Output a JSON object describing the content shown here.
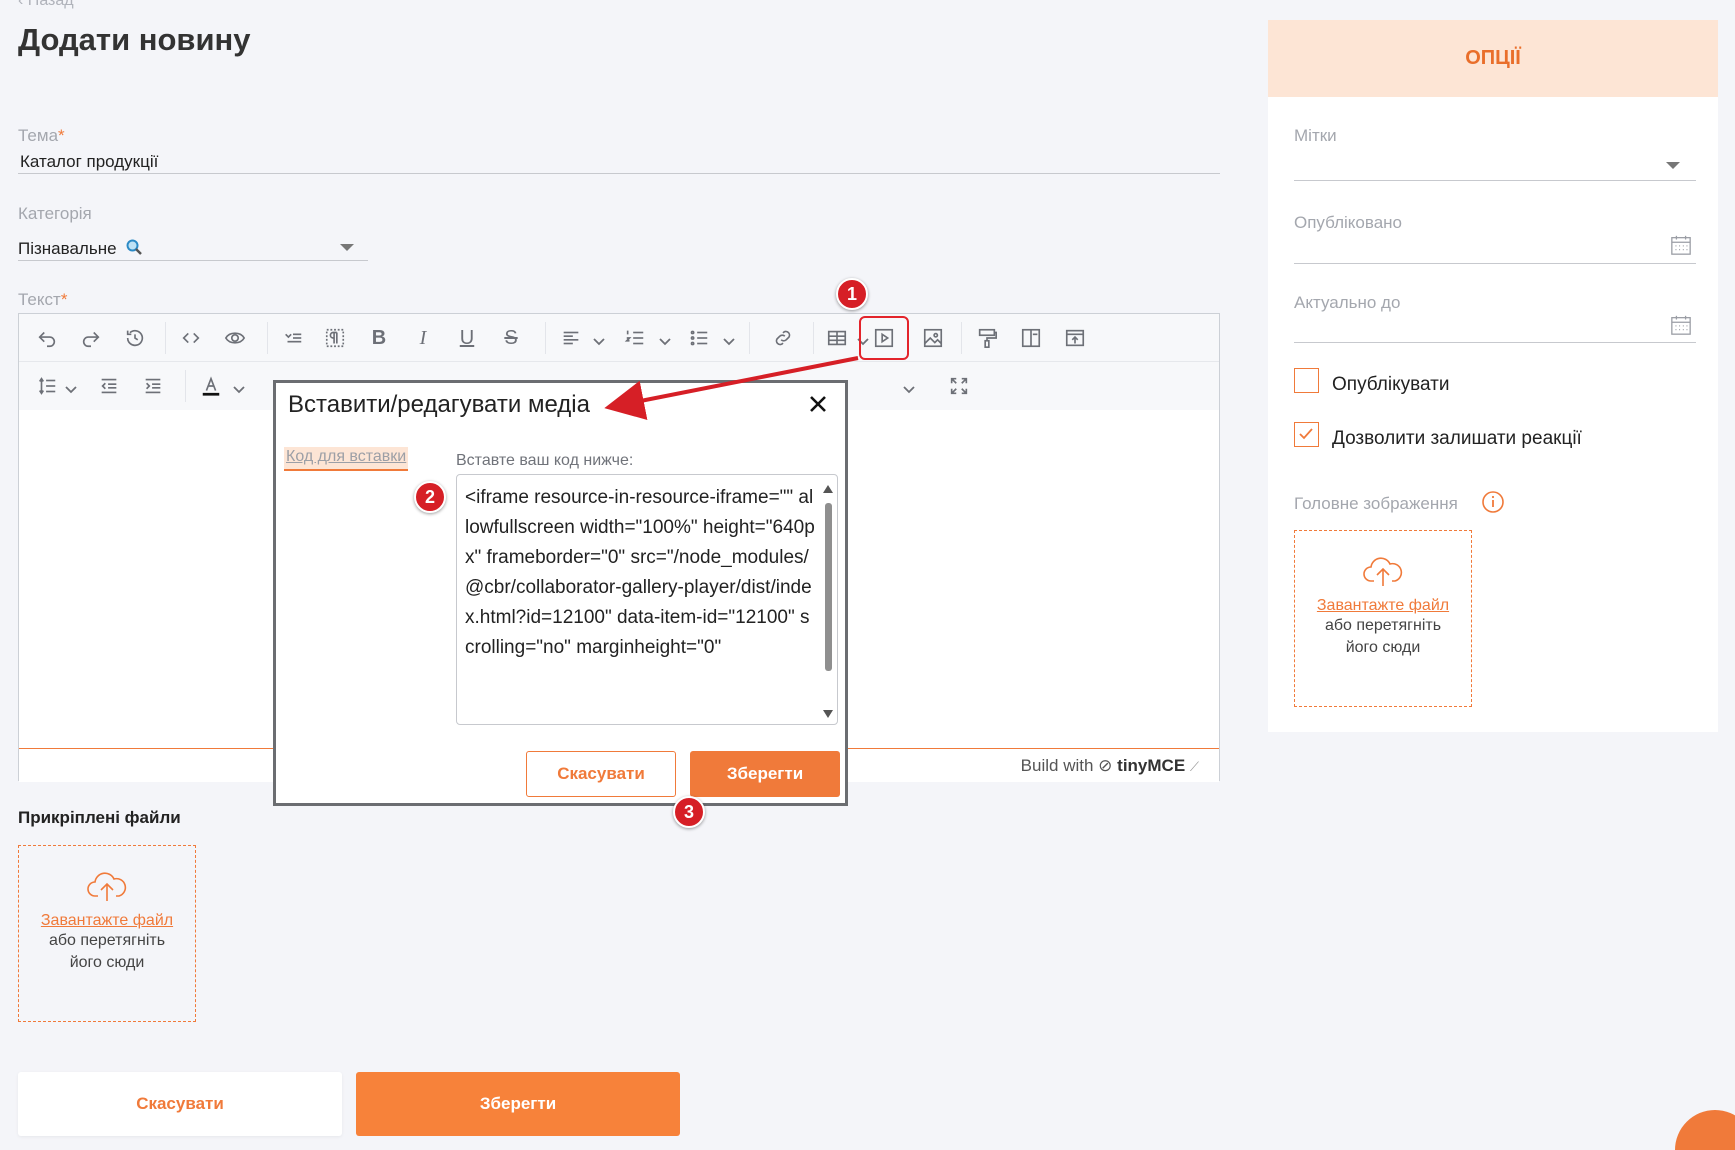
{
  "page": {
    "back_label": "Назад",
    "title": "Додати новину"
  },
  "form": {
    "topic_label": "Тема",
    "topic_value": "Каталог продукції",
    "category_label": "Категорія",
    "category_value": "Пізнавальне",
    "text_label": "Текст",
    "required_mark": "*"
  },
  "editor": {
    "branding_prefix": "Build with",
    "branding_name": "tinyMCE"
  },
  "attachments": {
    "title": "Прикріплені файли",
    "upload_link": "Завантажте файл",
    "upload_rest_1": "або перетягніть",
    "upload_rest_2": "його сюди"
  },
  "actions": {
    "cancel": "Скасувати",
    "save": "Зберегти"
  },
  "options": {
    "header": "ОПЦІЇ",
    "tags_label": "Мітки",
    "published_label": "Опубліковано",
    "actual_until_label": "Актуально до",
    "publish_label": "Опублікувати",
    "publish_checked": false,
    "allow_reactions_label": "Дозволити залишати реакції",
    "allow_reactions_checked": true,
    "main_image_label": "Головне зображення",
    "upload_link": "Завантажте файл",
    "upload_rest_1": "або перетягніть",
    "upload_rest_2": "його сюди"
  },
  "modal": {
    "title": "Вставити/редагувати медіа",
    "tab_label": "Код для вставки",
    "instruction": "Вставте ваш код нижче:",
    "code": "<iframe resource-in-resource-iframe=\"\" allowfullscreen width=\"100%\" height=\"640px\" frameborder=\"0\" src=\"/node_modules/@cbr/collaborator-gallery-player/dist/index.html?id=12100\" data-item-id=\"12100\" scrolling=\"no\" marginheight=\"0\"",
    "cancel": "Скасувати",
    "save": "Зберегти"
  },
  "callouts": {
    "one": "1",
    "two": "2",
    "three": "3"
  },
  "colors": {
    "accent": "#f07a3a",
    "callout": "#d61f26"
  }
}
